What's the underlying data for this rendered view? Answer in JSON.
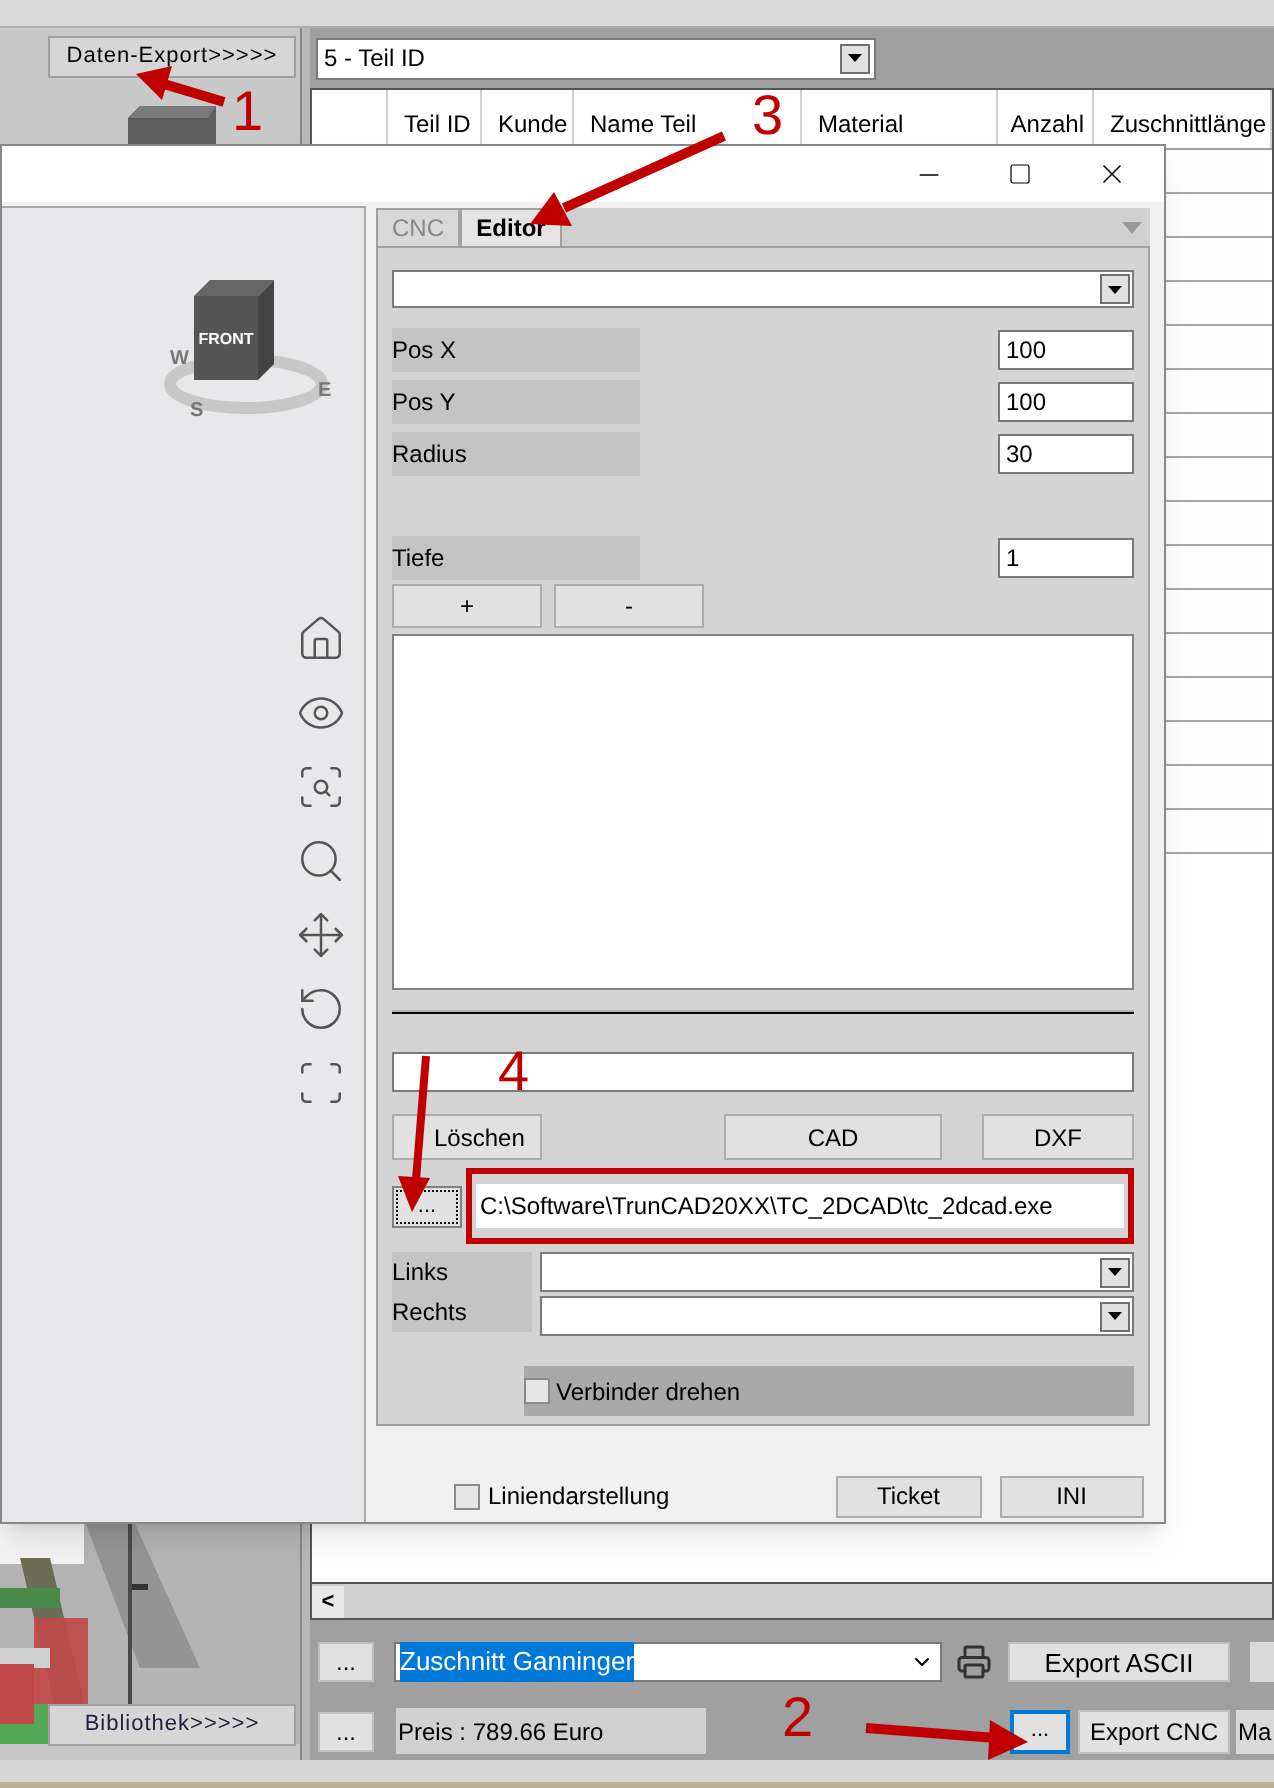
{
  "main": {
    "export_button": "Daten-Export>>>>>",
    "library_button": "Bibliothek>>>>>",
    "sort_select": "5 - Teil ID",
    "table": {
      "columns": [
        "Teil ID",
        "Kunde",
        "Name Teil",
        "Material",
        "Anzahl",
        "Zuschnittlänge"
      ]
    },
    "scroll_left": "<"
  },
  "bottom": {
    "more_button_1": "...",
    "profile_select": {
      "value": "Zuschnitt Ganninger",
      "selected": true
    },
    "export_ascii": "Export ASCII",
    "more_button_2": "...",
    "price": "Preis : 789.66 Euro",
    "cnc_more_button": {
      "label": "...",
      "focused": true
    },
    "export_cnc": "Export CNC",
    "cut_button": "Ma"
  },
  "dialog": {
    "tabs": [
      {
        "label": "CNC",
        "selected": false
      },
      {
        "label": "Editor",
        "selected": true
      }
    ],
    "view_cube": {
      "face": "FRONT",
      "compass": [
        "W",
        "S",
        "E"
      ]
    },
    "fields": [
      {
        "label": "Pos X",
        "value": "100"
      },
      {
        "label": "Pos Y",
        "value": "100"
      },
      {
        "label": "Radius",
        "value": "30"
      }
    ],
    "depth": {
      "label": "Tiefe",
      "value": "1"
    },
    "list_buttons": [
      "+",
      "-"
    ],
    "delete_button": "Löschen",
    "cad_button": "CAD",
    "dxf_button": "DXF",
    "browse_button": "...",
    "cad_path": "C:\\Software\\TrunCAD20XX\\TC_2DCAD\\tc_2dcad.exe",
    "sides": [
      {
        "label": "Links"
      },
      {
        "label": "Rechts"
      }
    ],
    "rotate_connector": {
      "label": "Verbinder drehen",
      "checked": false
    },
    "line_display": {
      "label": "Liniendarstellung",
      "checked": false
    },
    "ticket_button": "Ticket",
    "ini_button": "INI"
  },
  "annotations": [
    {
      "number": "1"
    },
    {
      "number": "2"
    },
    {
      "number": "3"
    },
    {
      "number": "4"
    }
  ]
}
